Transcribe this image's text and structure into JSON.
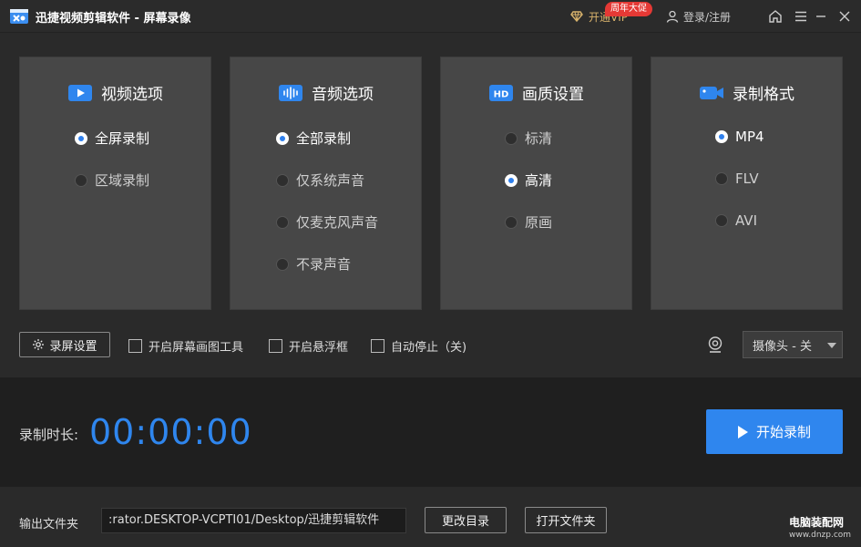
{
  "titlebar": {
    "title": "迅捷视频剪辑软件 - 屏幕录像",
    "vip_label": "开通VIP",
    "promo_badge": "周年大促",
    "login_label": "登录/注册"
  },
  "panels": {
    "video": {
      "title": "视频选项",
      "options": [
        "全屏录制",
        "区域录制"
      ],
      "selected": 0
    },
    "audio": {
      "title": "音频选项",
      "options": [
        "全部录制",
        "仅系统声音",
        "仅麦克风声音",
        "不录声音"
      ],
      "selected": 0
    },
    "quality": {
      "title": "画质设置",
      "icon_text": "HD",
      "options": [
        "标清",
        "高清",
        "原画"
      ],
      "selected": 1
    },
    "format": {
      "title": "录制格式",
      "options": [
        "MP4",
        "FLV",
        "AVI"
      ],
      "selected": 0
    }
  },
  "tools": {
    "settings_label": "录屏设置",
    "checkboxes": [
      {
        "label": "开启屏幕画图工具",
        "checked": false
      },
      {
        "label": "开启悬浮框",
        "checked": false
      },
      {
        "label": "自动停止（关)",
        "checked": false
      }
    ],
    "camera_select": "摄像头 - 关"
  },
  "recording": {
    "duration_label": "录制时长:",
    "time": "00:00:00",
    "start_label": "开始录制"
  },
  "output": {
    "label": "输出文件夹",
    "path": ":rator.DESKTOP-VCPTI01/Desktop/迅捷剪辑软件",
    "change_label": "更改目录",
    "open_label": "打开文件夹"
  },
  "watermark": {
    "name": "电脑装配网",
    "url": "www.dnzp.com"
  },
  "colors": {
    "accent": "#2f86ee",
    "vip_gold": "#d9b36c",
    "promo_red": "#e53935"
  },
  "icons": [
    "app-logo-icon",
    "diamond-icon",
    "user-icon",
    "home-icon",
    "menu-icon",
    "minimize-icon",
    "close-icon",
    "video-icon",
    "audio-wave-icon",
    "hd-icon",
    "camera-video-icon",
    "gear-icon",
    "webcam-icon",
    "play-icon"
  ]
}
